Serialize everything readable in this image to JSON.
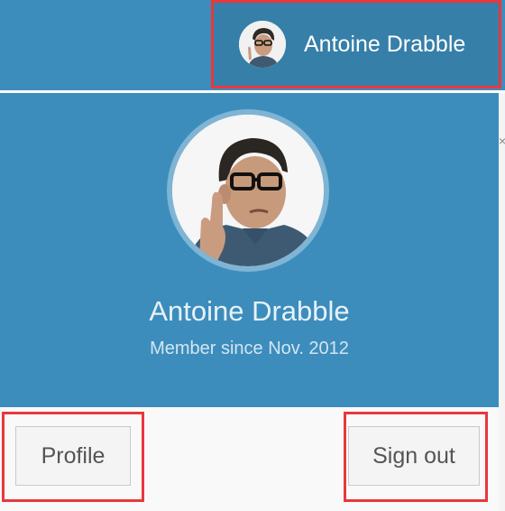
{
  "navbar": {
    "user_name": "Antoine Drabble",
    "avatar_icon": "user-avatar-icon"
  },
  "user_header": {
    "name": "Antoine Drabble",
    "member_since": "Member since Nov. 2012"
  },
  "footer": {
    "profile_label": "Profile",
    "signout_label": "Sign out"
  },
  "edge_glyph": "×",
  "colors": {
    "primary": "#3c8dbc",
    "primary_dark": "#367fa9",
    "highlight": "#e8383d"
  }
}
